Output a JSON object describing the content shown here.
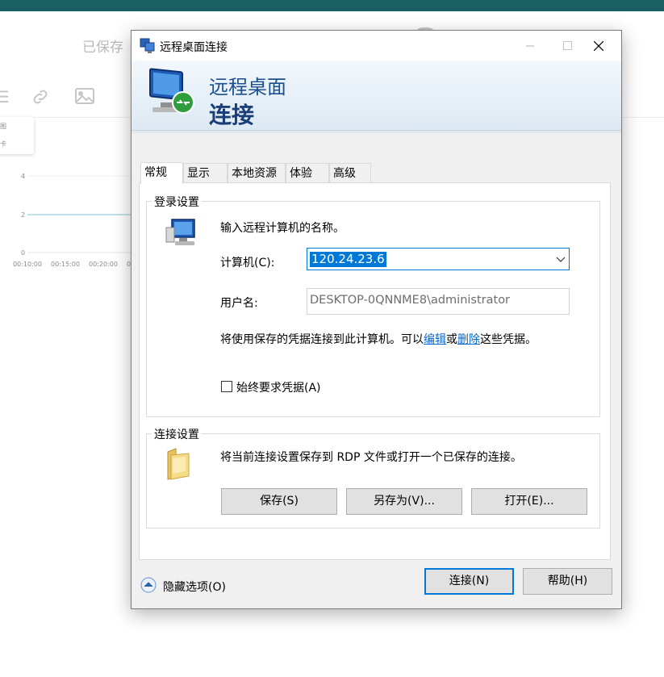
{
  "background": {
    "saved_text": "已保存",
    "menu_items": [
      "图",
      "卡"
    ],
    "chart_y_ticks": [
      "4",
      "2",
      "0"
    ],
    "chart_x_ticks": [
      "00:10:00",
      "00:15:00",
      "00:20:00",
      "0"
    ]
  },
  "dialog": {
    "title": "远程桌面连接",
    "banner_line1": "远程桌面",
    "banner_line2": "连接",
    "tabs": [
      {
        "label": "常规",
        "active": true
      },
      {
        "label": "显示",
        "active": false
      },
      {
        "label": "本地资源",
        "active": false
      },
      {
        "label": "体验",
        "active": false
      },
      {
        "label": "高级",
        "active": false
      }
    ],
    "login": {
      "group_label": "登录设置",
      "instruction": "输入远程计算机的名称。",
      "computer_label": "计算机(C):",
      "computer_value": "120.24.23.6",
      "username_label": "用户名:",
      "username_value": "DESKTOP-0QNNME8\\administrator",
      "cred_text_before": "将使用保存的凭据连接到此计算机。可以",
      "cred_link_edit": "编辑",
      "cred_text_or": "或",
      "cred_link_delete": "删除",
      "cred_text_after": "这些凭据。",
      "always_ask_label": "始终要求凭据(A)",
      "always_ask_checked": false
    },
    "connection": {
      "group_label": "连接设置",
      "description": "将当前连接设置保存到 RDP 文件或打开一个已保存的连接。",
      "save_button": "保存(S)",
      "save_as_button": "另存为(V)...",
      "open_button": "打开(E)..."
    },
    "footer": {
      "hide_options_label": "隐藏选项(O)",
      "connect_button": "连接(N)",
      "help_button": "帮助(H)"
    }
  }
}
